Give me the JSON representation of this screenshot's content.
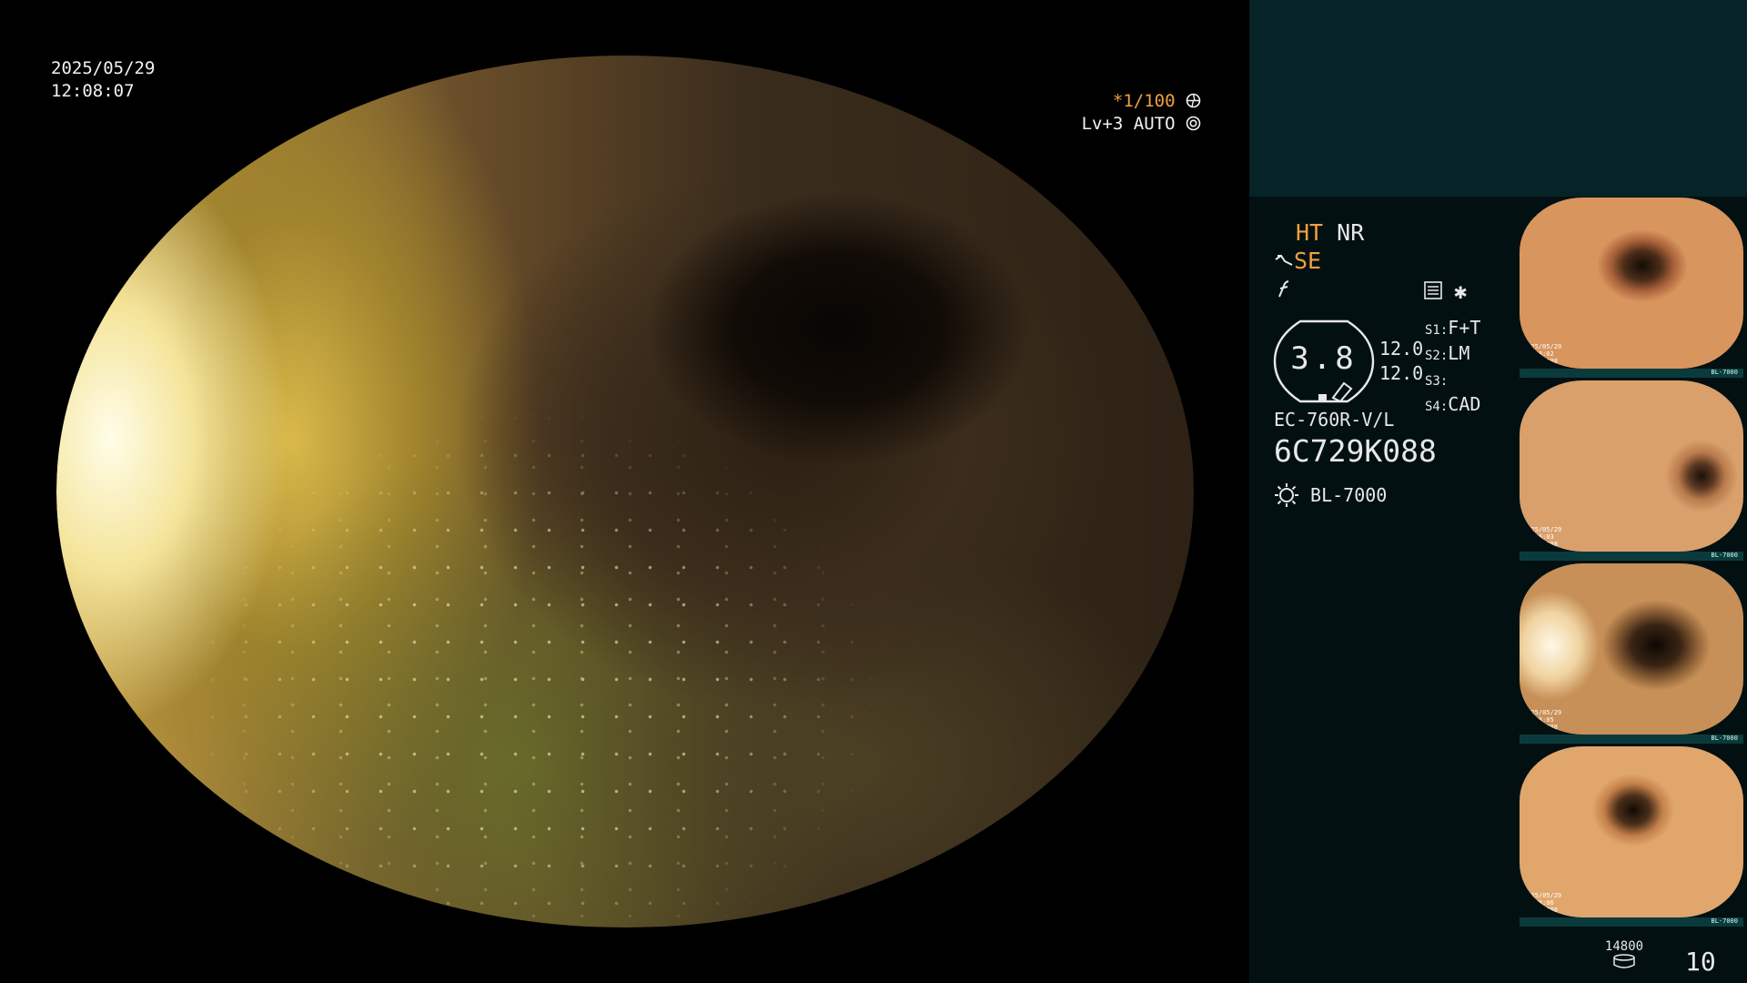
{
  "datetime": {
    "date": "2025/05/29",
    "time": "12:08:07"
  },
  "scope_osd": {
    "shutter": "*1/100",
    "iris": "Lv+3 AUTO",
    "shutter_icon": "aperture-icon",
    "iris_icon": "iris-auto-icon"
  },
  "panel": {
    "mode_ht": "HT",
    "mode_nr": "NR",
    "mode_se": "SE",
    "zoom_value": "3.8",
    "vals": [
      "12.0",
      "12.0"
    ],
    "switches": [
      {
        "key": "S1:",
        "val": "F+T"
      },
      {
        "key": "S2:",
        "val": "LM"
      },
      {
        "key": "S3:",
        "val": ""
      },
      {
        "key": "S4:",
        "val": "CAD"
      }
    ],
    "scope_model": "EC-760R-V/L",
    "serial": "6C729K088",
    "light_source": "BL-7000",
    "storage_count": "14800",
    "frame_count": "10"
  },
  "thumbnails": [
    {
      "date": "2025/05/29",
      "time": "12:08:02",
      "serial": "6C729K088",
      "lightsource": "BL-7000",
      "num": "6"
    },
    {
      "date": "2025/05/29",
      "time": "12:08:03",
      "serial": "6C729K088",
      "lightsource": "BL-7000",
      "num": "7"
    },
    {
      "date": "2025/05/29",
      "time": "12:08:05",
      "serial": "6C729K088",
      "lightsource": "BL-7000",
      "num": "8"
    },
    {
      "date": "2025/05/29",
      "time": "12:08:06",
      "serial": "6C729K088",
      "lightsource": "BL-7000",
      "num": "9"
    }
  ],
  "colors": {
    "accent": "#f0a040",
    "panel_bg": "#031012",
    "panel_top": "#062427"
  }
}
